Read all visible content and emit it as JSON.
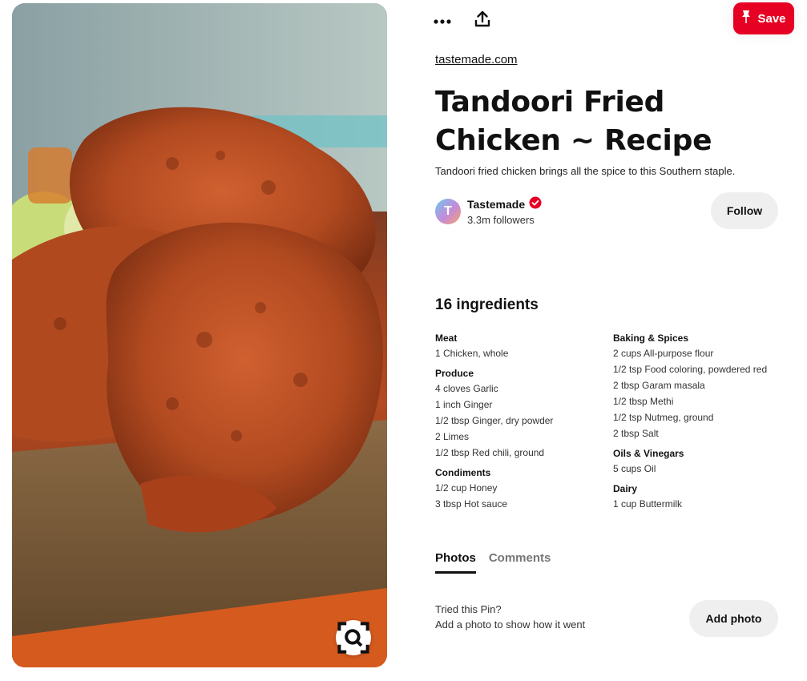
{
  "image": {
    "alt_icon": "visual-search-icon"
  },
  "toolbar": {
    "more_icon": "more-options-icon",
    "share_icon": "share-upload-icon",
    "save_label": "Save",
    "save_icon": "pin-icon",
    "save_color": "#e60023"
  },
  "source": {
    "domain": "tastemade.com"
  },
  "pin": {
    "title": "Tandoori Fried Chicken ~ Recipe",
    "description": "Tandoori fried chicken brings all the spice to this Southern staple."
  },
  "creator": {
    "avatar_letter": "T",
    "name": "Tastemade",
    "verified_icon": "verified-badge-icon",
    "followers": "3.3m followers",
    "follow_label": "Follow"
  },
  "ingredients": {
    "heading": "16 ingredients",
    "left_column": [
      {
        "category": "Meat",
        "items": [
          "1 Chicken, whole"
        ]
      },
      {
        "category": "Produce",
        "items": [
          "4 cloves Garlic",
          "1 inch Ginger",
          "1/2 tbsp Ginger, dry powder",
          "2 Limes",
          "1/2 tbsp Red chili, ground"
        ]
      },
      {
        "category": "Condiments",
        "items": [
          "1/2 cup Honey",
          "3 tbsp Hot sauce"
        ]
      }
    ],
    "right_column": [
      {
        "category": "Baking & Spices",
        "items": [
          "2 cups All-purpose flour",
          "1/2 tsp Food coloring, powdered red",
          "2 tbsp Garam masala",
          "1/2 tbsp Methi",
          "1/2 tsp Nutmeg, ground",
          "2 tbsp Salt"
        ]
      },
      {
        "category": "Oils & Vinegars",
        "items": [
          "5 cups Oil"
        ]
      },
      {
        "category": "Dairy",
        "items": [
          "1 cup Buttermilk"
        ]
      }
    ]
  },
  "tabs": [
    {
      "label": "Photos",
      "active": true
    },
    {
      "label": "Comments",
      "active": false
    }
  ],
  "tried": {
    "line1": "Tried this Pin?",
    "line2": "Add a photo to show how it went",
    "button_label": "Add photo"
  }
}
